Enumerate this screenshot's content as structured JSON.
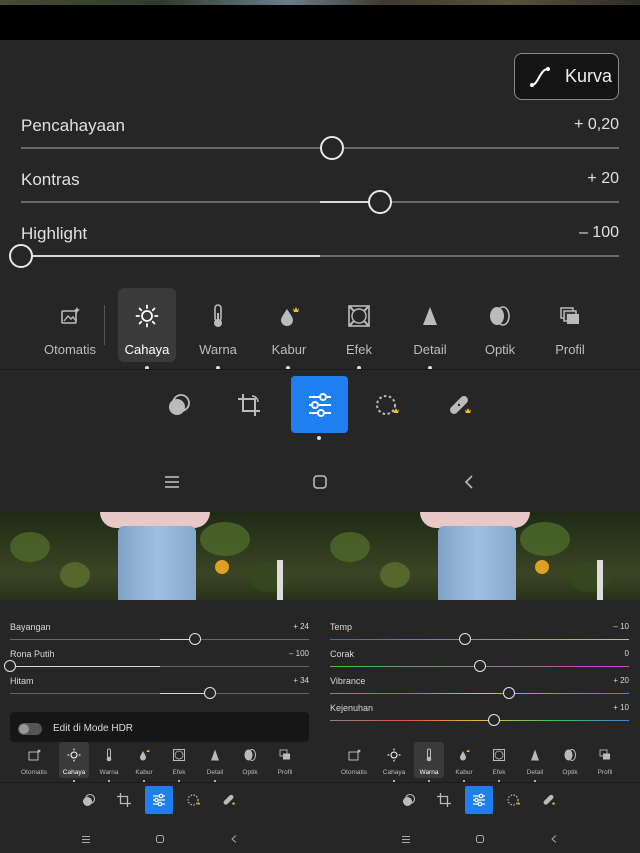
{
  "curve_button": {
    "label": "Kurva",
    "icon": "curve-icon"
  },
  "sliders": [
    {
      "label": "Pencahayaan",
      "value_text": "+ 0,20",
      "position": 0.52
    },
    {
      "label": "Kontras",
      "value_text": "+ 20",
      "position": 0.6
    },
    {
      "label": "Highlight",
      "value_text": "– 100",
      "position": 0.0
    }
  ],
  "tabs": [
    {
      "label": "Otomatis",
      "icon": "auto-icon"
    },
    {
      "label": "Cahaya",
      "icon": "sun-icon",
      "active": true
    },
    {
      "label": "Warna",
      "icon": "thermometer-icon"
    },
    {
      "label": "Kabur",
      "icon": "blur-drop-icon",
      "premium": true
    },
    {
      "label": "Efek",
      "icon": "vignette-icon"
    },
    {
      "label": "Detail",
      "icon": "triangle-icon"
    },
    {
      "label": "Optik",
      "icon": "lens-icon"
    },
    {
      "label": "Profil",
      "icon": "profile-stack-icon"
    }
  ],
  "tools": [
    {
      "name": "presets",
      "icon": "presets-icon"
    },
    {
      "name": "crop",
      "icon": "crop-icon"
    },
    {
      "name": "edit",
      "icon": "sliders-icon",
      "active": true
    },
    {
      "name": "masking",
      "icon": "mask-icon",
      "premium": true
    },
    {
      "name": "healing",
      "icon": "bandage-icon",
      "premium": true
    }
  ],
  "nav": [
    "menu-icon",
    "home-icon",
    "back-icon"
  ],
  "left_panel": {
    "sliders": [
      {
        "label": "Bayangan",
        "value_text": "+ 24",
        "position": 0.62
      },
      {
        "label": "Rona Putih",
        "value_text": "– 100",
        "position": 0.0
      },
      {
        "label": "Hitam",
        "value_text": "+ 34",
        "position": 0.67
      }
    ],
    "hdr_label": "Edit di Mode HDR",
    "active_tab": "Cahaya"
  },
  "right_panel": {
    "sliders": [
      {
        "label": "Temp",
        "value_text": "– 10",
        "position": 0.45,
        "gradient": "linear-gradient(90deg,#4a58e8,#c8c840)"
      },
      {
        "label": "Corak",
        "value_text": "0",
        "position": 0.5,
        "gradient": "linear-gradient(90deg,#40c040,#d040d0)"
      },
      {
        "label": "Vibrance",
        "value_text": "+ 20",
        "position": 0.6,
        "gradient": "linear-gradient(90deg,#888,#e05040,#e0c040,#40c060,#4080e0)"
      },
      {
        "label": "Kejenuhan",
        "value_text": "+ 10",
        "position": 0.55,
        "gradient": "linear-gradient(90deg,#888,#e05040,#e0c040,#40c060,#4080e0)"
      }
    ],
    "active_tab": "Warna"
  },
  "colors": {
    "accent": "#1f7ff0",
    "panel": "#262626",
    "premium": "#f0c020"
  }
}
